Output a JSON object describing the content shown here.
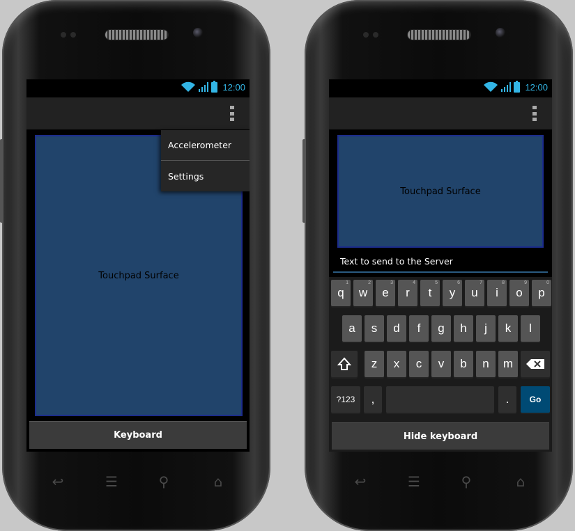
{
  "status_bar": {
    "time": "12:00"
  },
  "left": {
    "touchpad_label": "Touchpad Surface",
    "menu": {
      "items": [
        "Accelerometer",
        "Settings"
      ]
    },
    "keyboard_button": "Keyboard"
  },
  "right": {
    "touchpad_label": "Touchpad Surface",
    "text_field_placeholder": "Text to send to the Server",
    "hide_keyboard_button": "Hide keyboard",
    "keyboard": {
      "row1": [
        "q",
        "w",
        "e",
        "r",
        "t",
        "y",
        "u",
        "i",
        "o",
        "p"
      ],
      "row1_hints": [
        "1",
        "2",
        "3",
        "4",
        "5",
        "6",
        "7",
        "8",
        "9",
        "0"
      ],
      "row2": [
        "a",
        "s",
        "d",
        "f",
        "g",
        "h",
        "j",
        "k",
        "l"
      ],
      "row3": [
        "z",
        "x",
        "c",
        "v",
        "b",
        "n",
        "m"
      ],
      "symbols_key": "?123",
      "comma_key": ",",
      "period_key": ".",
      "go_key": "Go"
    }
  },
  "colors": {
    "accent": "#33b5e5",
    "touchpad": "#21446b",
    "touchpad_border": "#1c2c8c",
    "go_key": "#004a74"
  },
  "icons": [
    "wifi-icon",
    "signal-icon",
    "battery-icon",
    "overflow-menu-icon",
    "shift-icon",
    "backspace-icon",
    "back-icon",
    "recent-apps-icon",
    "search-icon",
    "home-icon"
  ]
}
